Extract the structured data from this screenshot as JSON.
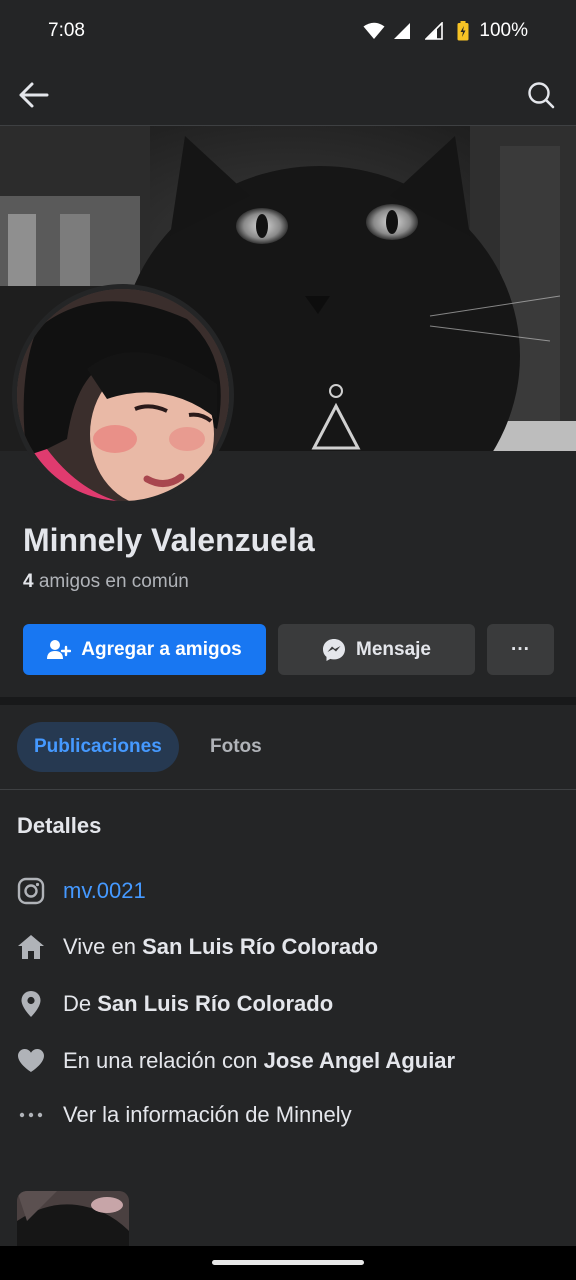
{
  "status_bar": {
    "time": "7:08",
    "battery": "100%"
  },
  "top_bar": {
    "back_icon": "arrow-left-icon",
    "search_icon": "search-icon"
  },
  "profile": {
    "name": "Minnely Valenzuela",
    "mutual_count": "4",
    "mutual_text": " amigos en común"
  },
  "actions": {
    "add_friend": "Agregar a amigos",
    "message": "Mensaje",
    "more": "···"
  },
  "tabs": [
    {
      "label": "Publicaciones",
      "active": true
    },
    {
      "label": "Fotos",
      "active": false
    }
  ],
  "details": {
    "title": "Detalles",
    "instagram": {
      "icon": "instagram-icon",
      "handle": "mv.0021"
    },
    "lives_in": {
      "icon": "home-icon",
      "prefix": "Vive en ",
      "value": "San Luis Río Colorado"
    },
    "from": {
      "icon": "location-pin-icon",
      "prefix": "De ",
      "value": "San Luis Río Colorado"
    },
    "relationship": {
      "icon": "heart-icon",
      "prefix": "En una relación con ",
      "value": "Jose Angel Aguiar"
    },
    "see_info": {
      "icon": "more-dots-icon",
      "text": "Ver la información de Minnely"
    }
  },
  "colors": {
    "background": "#242526",
    "primary_blue": "#1877f2",
    "link_blue": "#4599ff",
    "secondary_button": "#3a3b3c",
    "active_tab_bg": "#263951"
  }
}
